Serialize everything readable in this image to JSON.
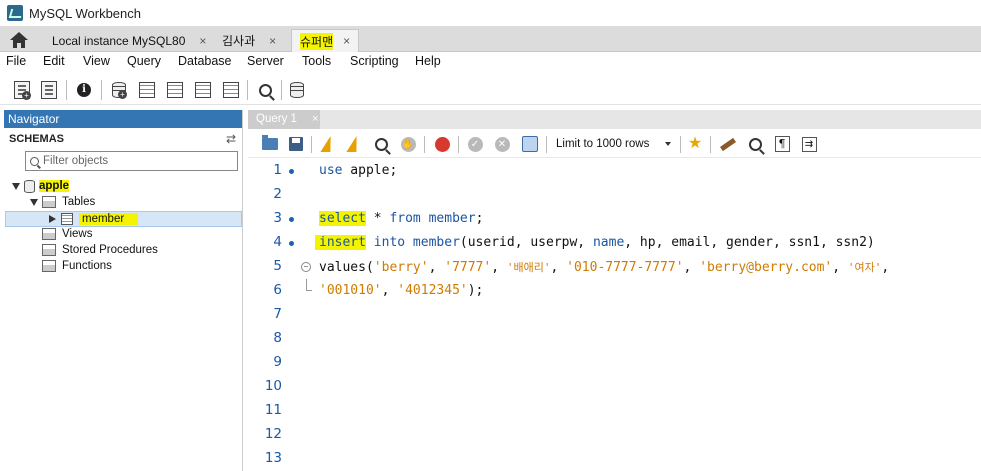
{
  "window": {
    "title": "MySQL Workbench"
  },
  "tabs": [
    {
      "label": "Local instance MySQL80",
      "close": "×"
    },
    {
      "label": "김사과",
      "close": "×"
    },
    {
      "label": "슈퍼맨",
      "close": "×"
    }
  ],
  "menu": [
    "File",
    "Edit",
    "View",
    "Query",
    "Database",
    "Server",
    "Tools",
    "Scripting",
    "Help"
  ],
  "navigator": {
    "header": "Navigator",
    "schemas_label": "SCHEMAS",
    "filter_placeholder": "Filter objects",
    "schema": "apple",
    "tables_label": "Tables",
    "table": "member",
    "views_label": "Views",
    "procedures_label": "Stored Procedures",
    "functions_label": "Functions"
  },
  "query_tab": {
    "label": "Query 1",
    "close": "×"
  },
  "editor_toolbar": {
    "limit_label": "Limit to 1000 rows"
  },
  "editor": {
    "line_numbers": [
      "1",
      "2",
      "3",
      "4",
      "5",
      "6",
      "7",
      "8",
      "9",
      "10",
      "11",
      "12",
      "13"
    ],
    "line1": {
      "kw": "use",
      "rest": " apple;"
    },
    "line3": {
      "kw1": "select",
      "mid": " * ",
      "kw2": "from",
      "kw3": " member",
      "end": ";"
    },
    "line4": {
      "kw1": "insert",
      "kw2": " into",
      "kw3": " member",
      "rest1": "(userid, userpw, ",
      "kw4": "name",
      "rest2": ", hp, email, gender, ssn1, ssn2)"
    },
    "line5": {
      "pre": "values(",
      "s1": "'berry'",
      "c1": ", ",
      "s2": "'7777'",
      "c2": ", ",
      "s3": "'배애리'",
      "c3": ", ",
      "s4": "'010-7777-7777'",
      "c4": ", ",
      "s5": "'berry@berry.com'",
      "c5": ", ",
      "s6": "'여자'",
      "c6": ","
    },
    "line6": {
      "s1": "'001010'",
      "c1": ", ",
      "s2": "'4012345'",
      "end": ");"
    }
  },
  "colors": {
    "accent": "#3476b4",
    "highlight": "#f4f400",
    "keyword": "#1a56a0",
    "string": "#d07b00"
  }
}
